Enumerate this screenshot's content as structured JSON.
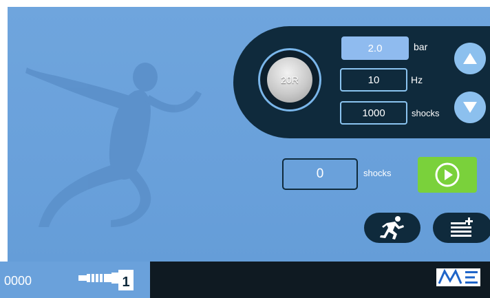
{
  "therapy_panel": {
    "applicator_label": "20R",
    "pressure": {
      "value": "2.0",
      "unit": "bar"
    },
    "frequency": {
      "value": "10",
      "unit": "Hz"
    },
    "shocks": {
      "value": "1000",
      "unit": "shocks"
    }
  },
  "counter": {
    "value": "0",
    "unit": "shocks"
  },
  "bottom_bar": {
    "shot_count": "0000",
    "handpiece_slot": "1"
  },
  "icons": {
    "increase": "triangle-up-icon",
    "decrease": "triangle-down-icon",
    "start": "play-icon",
    "indications": "runner-icon",
    "protocols": "list-add-icon",
    "brand": "me-logo"
  },
  "colors": {
    "screen": "#6aa1db",
    "panel": "#0f2a3c",
    "selected_field": "#8fbbef",
    "start_button": "#7ad13b",
    "bottom_bar": "#0f1a22"
  }
}
